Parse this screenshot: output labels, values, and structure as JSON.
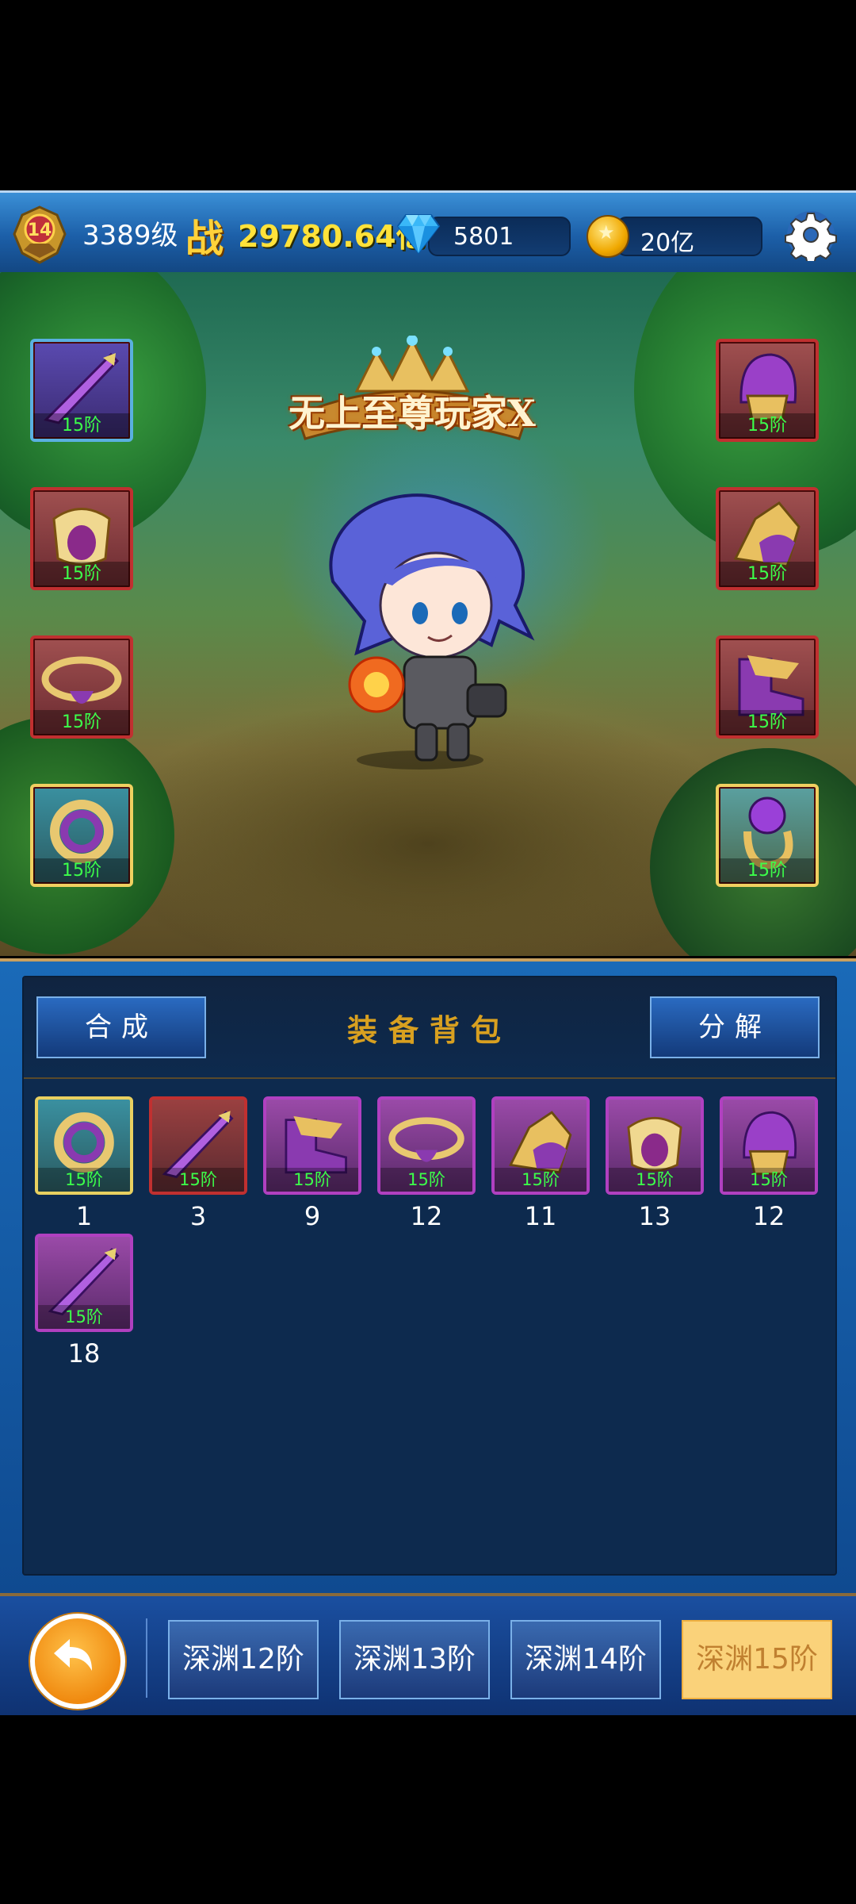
{
  "header": {
    "rank_badge_value": "14",
    "level": "3389级",
    "power_icon": "战",
    "power_value": "29780.64亿",
    "diamonds": "5801",
    "gold": "20亿",
    "icons": [
      "rank-badge-icon",
      "diamond-icon",
      "gold-coin-icon",
      "gear-icon"
    ]
  },
  "character": {
    "title": "无上至尊玩家X"
  },
  "equip_slots": {
    "left": [
      {
        "item": "dagger",
        "tier": "15阶"
      },
      {
        "item": "armor",
        "tier": "15阶"
      },
      {
        "item": "belt",
        "tier": "15阶"
      },
      {
        "item": "necklace",
        "tier": "15阶"
      }
    ],
    "right": [
      {
        "item": "helmet",
        "tier": "15阶"
      },
      {
        "item": "gauntlet",
        "tier": "15阶"
      },
      {
        "item": "boots",
        "tier": "15阶"
      },
      {
        "item": "ring",
        "tier": "15阶"
      }
    ]
  },
  "bag": {
    "compose_label": "合成",
    "title": "装备背包",
    "decompose_label": "分解",
    "items": [
      {
        "item": "necklace",
        "tier": "15阶",
        "count": "1"
      },
      {
        "item": "dagger",
        "tier": "15阶",
        "count": "3"
      },
      {
        "item": "boots",
        "tier": "15阶",
        "count": "9"
      },
      {
        "item": "belt",
        "tier": "15阶",
        "count": "12"
      },
      {
        "item": "gauntlet",
        "tier": "15阶",
        "count": "11"
      },
      {
        "item": "armor",
        "tier": "15阶",
        "count": "13"
      },
      {
        "item": "helmet",
        "tier": "15阶",
        "count": "12"
      },
      {
        "item": "dagger",
        "tier": "15阶",
        "count": "18"
      }
    ]
  },
  "footer": {
    "tabs": [
      "深渊12阶",
      "深渊13阶",
      "深渊14阶",
      "深渊15阶"
    ],
    "active_tab": "深渊15阶"
  },
  "colors": {
    "tier_text": "#3cff4a",
    "panel_title": "#d8a020",
    "active_tab_bg": "#fad27a"
  }
}
